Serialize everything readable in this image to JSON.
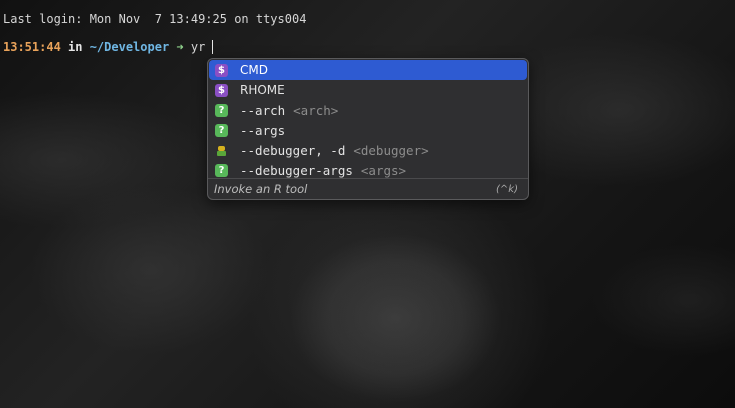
{
  "terminal": {
    "last_login": "Last login: Mon Nov  7 13:49:25 on ttys004",
    "prompt": {
      "time": "13:51:44",
      "in": " in ",
      "directory": "~/Developer",
      "arrow": " ➜ ",
      "command": "yr"
    }
  },
  "completion": {
    "items": [
      {
        "icon": "dollar-icon",
        "symbol": "$",
        "label": "CMD",
        "placeholder": "",
        "selected": true
      },
      {
        "icon": "dollar-icon",
        "symbol": "$",
        "label": "RHOME",
        "placeholder": "",
        "selected": false
      },
      {
        "icon": "question-icon",
        "symbol": "?",
        "label": "--arch",
        "placeholder": "<arch>",
        "selected": false
      },
      {
        "icon": "question-icon",
        "symbol": "?",
        "label": "--args",
        "placeholder": "",
        "selected": false
      },
      {
        "icon": "robot-icon",
        "symbol": "",
        "label": "--debugger, -d",
        "placeholder": "<debugger>",
        "selected": false
      },
      {
        "icon": "question-icon",
        "symbol": "?",
        "label": "--debugger-args",
        "placeholder": "<args>",
        "selected": false
      }
    ],
    "footer": {
      "description": "Invoke an R tool",
      "shortcut": "(^k)"
    }
  },
  "colors": {
    "selection": "#2e5bd2",
    "dollar_badge": "#8a4fc4",
    "question_badge": "#58b85a",
    "prompt_time": "#e8a25a",
    "prompt_dir": "#6fb6e3",
    "prompt_arrow": "#8fd18c"
  }
}
